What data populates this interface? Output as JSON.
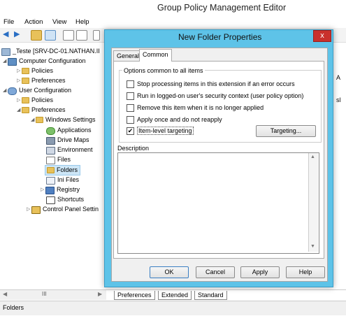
{
  "window": {
    "title": "Group Policy Management Editor",
    "menu": [
      "File",
      "Action",
      "View",
      "Help"
    ]
  },
  "tree": {
    "items": [
      {
        "label": "_Teste [SRV-DC-01.NATHAN.II",
        "icon": "policy-icon"
      },
      {
        "label": "Computer Configuration",
        "icon": "computer-icon"
      },
      {
        "label": "Policies",
        "icon": "folder-icon"
      },
      {
        "label": "Preferences",
        "icon": "folder-icon"
      },
      {
        "label": "User Configuration",
        "icon": "user-icon"
      },
      {
        "label": "Policies",
        "icon": "folder-icon"
      },
      {
        "label": "Preferences",
        "icon": "folder-icon"
      },
      {
        "label": "Windows Settings",
        "icon": "folder-icon"
      },
      {
        "label": "Applications",
        "icon": "applications-icon"
      },
      {
        "label": "Drive Maps",
        "icon": "drive-maps-icon"
      },
      {
        "label": "Environment",
        "icon": "environment-icon"
      },
      {
        "label": "Files",
        "icon": "files-icon"
      },
      {
        "label": "Folders",
        "icon": "folder-icon"
      },
      {
        "label": "Ini Files",
        "icon": "ini-files-icon"
      },
      {
        "label": "Registry",
        "icon": "registry-icon"
      },
      {
        "label": "Shortcuts",
        "icon": "shortcuts-icon"
      },
      {
        "label": "Control Panel Settin",
        "icon": "control-panel-icon"
      }
    ],
    "scroll_glyph": "III"
  },
  "right_edge_text": [
    "A",
    "sl"
  ],
  "bottom_tabs": [
    "Preferences",
    "Extended",
    "Standard"
  ],
  "status": "Folders",
  "dialog": {
    "title": "New Folder Properties",
    "close_glyph": "x",
    "tabs": [
      "General",
      "Common"
    ],
    "active_tab": "Common",
    "group_title": "Options common to all items",
    "options": [
      {
        "label": "Stop processing items in this extension if an error occurs",
        "checked": false
      },
      {
        "label": "Run in logged-on user's security context (user policy option)",
        "checked": false
      },
      {
        "label": "Remove this item when it is no longer applied",
        "checked": false
      },
      {
        "label": "Apply once and do not reapply",
        "checked": false
      },
      {
        "label": "Item-level targeting",
        "checked": true
      }
    ],
    "targeting_button": "Targeting...",
    "description_label": "Description",
    "description_value": "",
    "buttons": {
      "ok": "OK",
      "cancel": "Cancel",
      "apply": "Apply",
      "help": "Help"
    }
  }
}
